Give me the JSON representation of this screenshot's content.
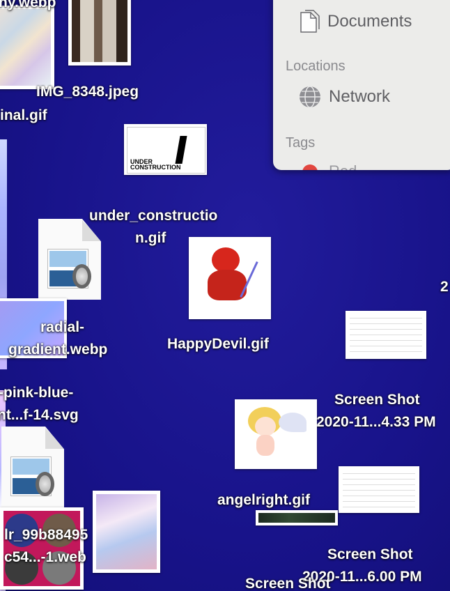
{
  "desktop": {
    "labels": {
      "top_partial": "ny.webp",
      "img8348": "IMG_8348.jpeg",
      "inal": "inal.gif",
      "under_construction_line1": "under_constructio",
      "under_construction_line2": "n.gif",
      "radial_line1": "radial-",
      "radial_line2": "gradient.webp",
      "happy_devil": "HappyDevil.gif",
      "pink_line1": "-pink-blue-",
      "pink_line2": "nt...f-14.svg",
      "screenshot1_line1": "Screen Shot",
      "screenshot1_line2": "2020-11...4.33 PM",
      "angelright": "angelright.gif",
      "tumblr_line1": "lr_99b88495",
      "tumblr_line2": "c54...-1.web",
      "screenshot2_line1": "Screen Shot",
      "screenshot2_line2": "2020-11...6.00 PM",
      "screenshot3_line1": "Screen Shot",
      "right_edge_partial": "2"
    },
    "under_construction_text_1": "UNDER",
    "under_construction_text_2": "CONSTRUCTION"
  },
  "finder_sidebar": {
    "documents_label": "Documents",
    "locations_header": "Locations",
    "network_label": "Network",
    "tags_header": "Tags",
    "tag_partial": "Red"
  },
  "colors": {
    "desktop_bg": "#1a1590",
    "panel_bg": "#ececea",
    "tag_red": "#e2463f"
  },
  "icons": [
    "document-icon",
    "network-globe-icon",
    "preview-image-file-icon",
    "red-tag-dot-icon"
  ]
}
